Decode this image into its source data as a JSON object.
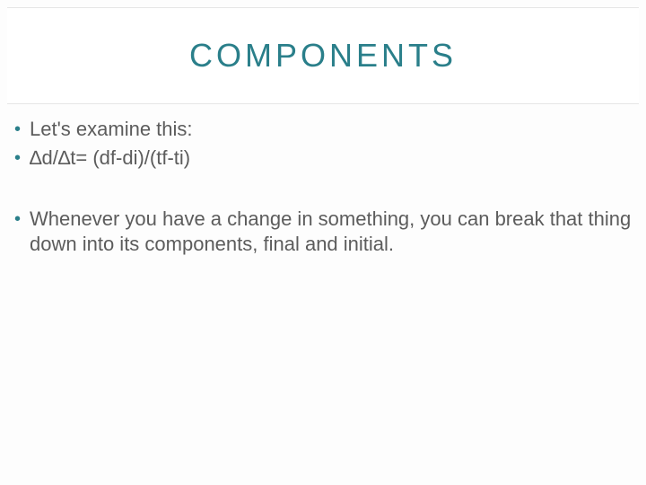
{
  "title": "COMPONENTS",
  "bullets": [
    "Let's examine this:",
    "∆d/∆t= (df-di)/(tf-ti)",
    "Whenever you have a change in something, you can break that thing down into its components, final and initial."
  ]
}
